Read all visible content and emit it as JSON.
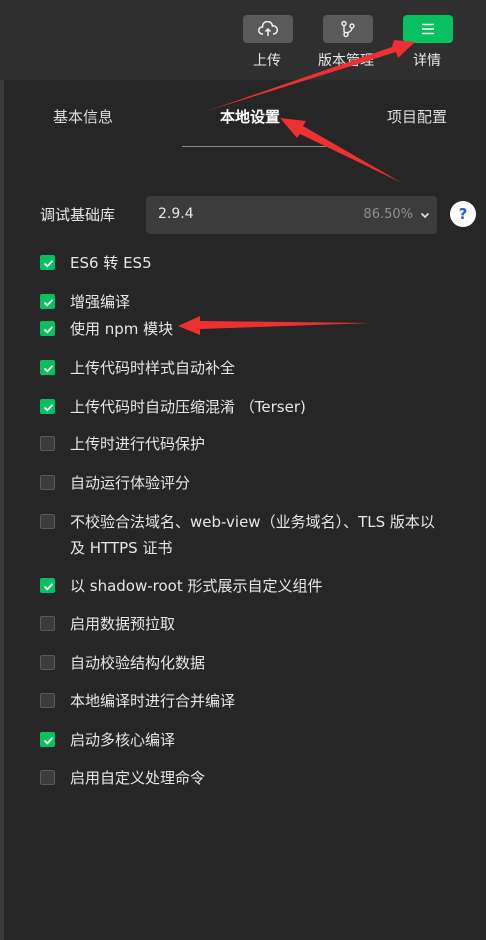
{
  "toolbar": {
    "buttons": [
      {
        "label": "上传",
        "icon": "cloud-upload-icon"
      },
      {
        "label": "版本管理",
        "icon": "branch-icon"
      },
      {
        "label": "详情",
        "icon": "menu-icon",
        "active": true
      }
    ]
  },
  "tabs": [
    {
      "label": "基本信息"
    },
    {
      "label": "本地设置",
      "active": true
    },
    {
      "label": "项目配置"
    }
  ],
  "base_library": {
    "label": "调试基础库",
    "version": "2.9.4",
    "coverage": "86.50%",
    "help_icon": "?"
  },
  "options": [
    {
      "label": "ES6 转 ES5",
      "checked": true
    },
    {
      "label": "增强编译",
      "checked": true
    },
    {
      "label": "使用 npm 模块",
      "checked": true
    },
    {
      "label": "上传代码时样式自动补全",
      "checked": true
    },
    {
      "label": "上传代码时自动压缩混淆 （Terser)",
      "checked": true
    },
    {
      "label": "上传时进行代码保护",
      "checked": false
    },
    {
      "label": "自动运行体验评分",
      "checked": false
    },
    {
      "label": "不校验合法域名、web-view（业务域名）、TLS 版本以及 HTTPS 证书",
      "checked": false
    },
    {
      "label": "以 shadow-root 形式展示自定义组件",
      "checked": true
    },
    {
      "label": "启用数据预拉取",
      "checked": false
    },
    {
      "label": "自动校验结构化数据",
      "checked": false
    },
    {
      "label": "本地编译时进行合并编译",
      "checked": false
    },
    {
      "label": "启动多核心编译",
      "checked": true
    },
    {
      "label": "启用自定义处理命令",
      "checked": false
    }
  ],
  "colors": {
    "accent": "#07c160",
    "annotation_arrow": "#ee3030"
  }
}
